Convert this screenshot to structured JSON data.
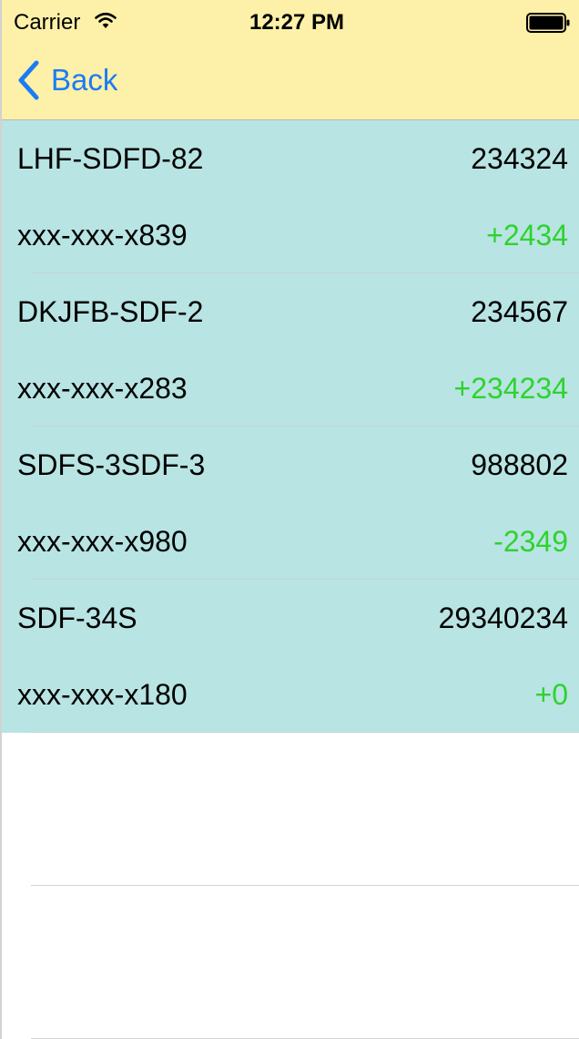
{
  "status_bar": {
    "carrier": "Carrier",
    "time": "12:27 PM"
  },
  "nav": {
    "back_label": "Back",
    "back_icon": "chevron-left-icon"
  },
  "colors": {
    "header_bg": "#fdf0a8",
    "cell_bg": "#b8e4e3",
    "accent": "#1a7cf5",
    "change_positive": "#2fd22f"
  },
  "rows": [
    {
      "code": "LHF-SDFD-82",
      "value": "234324",
      "account": "xxx-xxx-x839",
      "change": "+2434"
    },
    {
      "code": "DKJFB-SDF-2",
      "value": "234567",
      "account": "xxx-xxx-x283",
      "change": "+234234"
    },
    {
      "code": "SDFS-3SDF-3",
      "value": "988802",
      "account": "xxx-xxx-x980",
      "change": "-2349"
    },
    {
      "code": "SDF-34S",
      "value": "29340234",
      "account": "xxx-xxx-x180",
      "change": "+0"
    }
  ]
}
